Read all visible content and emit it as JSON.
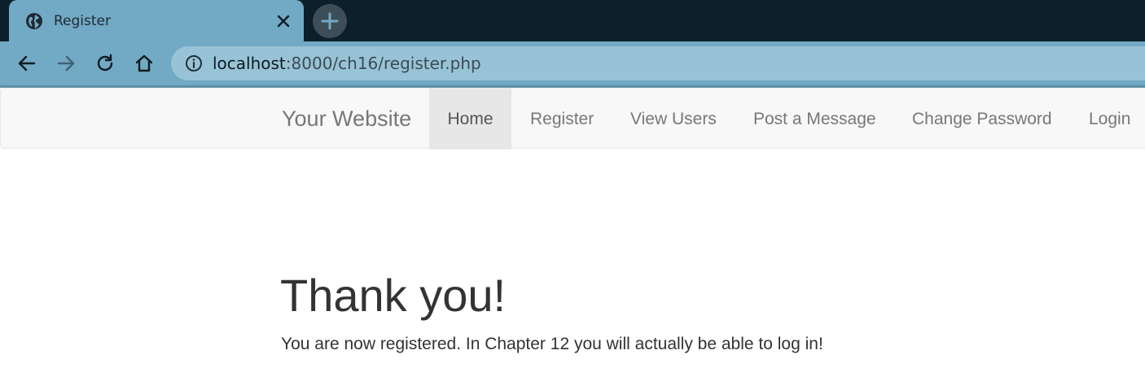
{
  "browser": {
    "tab_title": "Register",
    "url_host": "localhost",
    "url_path": ":8000/ch16/register.php"
  },
  "icons": {
    "favicon": "globe-icon",
    "close": "close-icon",
    "new_tab": "plus-icon",
    "back": "back-arrow-icon",
    "forward": "forward-arrow-icon",
    "reload": "reload-icon",
    "home": "home-icon",
    "site_info": "info-icon"
  },
  "colors": {
    "tabstrip": "#0c1f2b",
    "chrome": "#72a9c4",
    "omnibox": "#98c3d7",
    "navbar_bg": "#f8f8f8",
    "nav_text": "#777777",
    "active_nav_bg": "#e7e7e7",
    "body_text": "#333333"
  },
  "navbar": {
    "brand": "Your Website",
    "items": [
      {
        "label": "Home",
        "active": true
      },
      {
        "label": "Register",
        "active": false
      },
      {
        "label": "View Users",
        "active": false
      },
      {
        "label": "Post a Message",
        "active": false
      },
      {
        "label": "Change Password",
        "active": false
      },
      {
        "label": "Login",
        "active": false
      }
    ]
  },
  "main": {
    "heading": "Thank you!",
    "message": "You are now registered. In Chapter 12 you will actually be able to log in!"
  }
}
